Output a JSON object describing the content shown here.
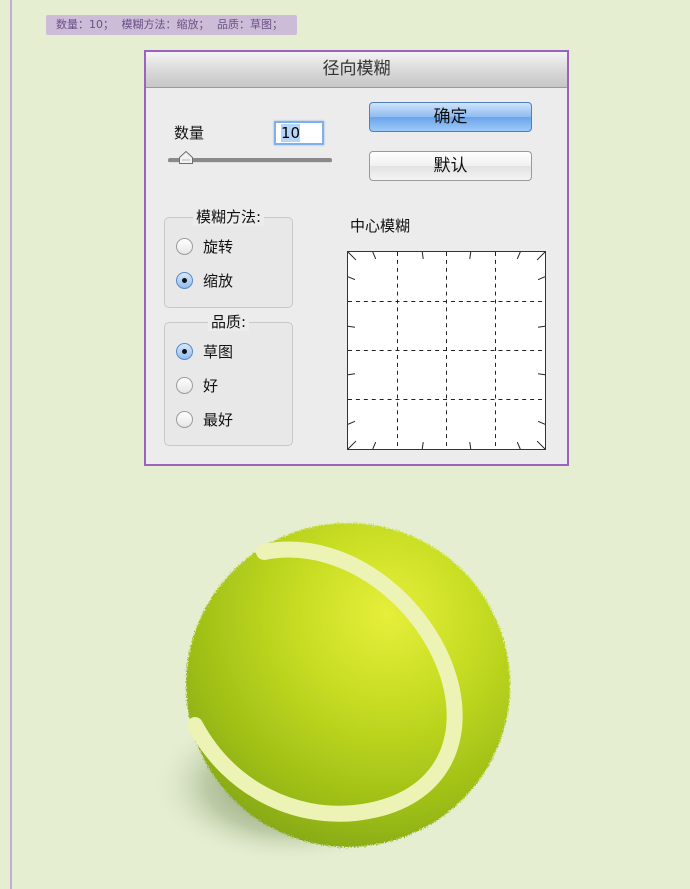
{
  "caption": {
    "amount": "数量：10；",
    "method": "模糊方法：缩放；",
    "quality": "品质：草图；"
  },
  "dialog": {
    "title": "径向模糊",
    "amount_label": "数量",
    "amount_value": "10",
    "ok_label": "确定",
    "default_label": "默认",
    "method_group": {
      "title": "模糊方法:",
      "options": [
        {
          "label": "旋转",
          "selected": false
        },
        {
          "label": "缩放",
          "selected": true
        }
      ]
    },
    "quality_group": {
      "title": "品质:",
      "options": [
        {
          "label": "草图",
          "selected": true
        },
        {
          "label": "好",
          "selected": false
        },
        {
          "label": "最好",
          "selected": false
        }
      ]
    },
    "center_label": "中心模糊"
  },
  "colors": {
    "page_background": "#e6eed2",
    "accent_border": "#9b62c0",
    "ok_button": "#6ba4ec",
    "ball": "#b6d31a"
  }
}
